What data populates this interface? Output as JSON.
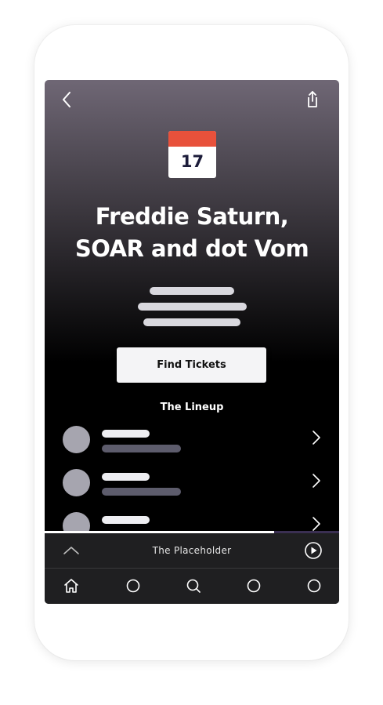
{
  "event": {
    "date_day": "17",
    "title_line1": "Freddie Saturn,",
    "title_line2": "SOAR and dot Vom"
  },
  "actions": {
    "find_tickets_label": "Find Tickets"
  },
  "lineup": {
    "heading": "The Lineup"
  },
  "player": {
    "track_title": "The Placeholder",
    "progress": 0.78
  },
  "nav": {
    "back_icon": "chevron-left-icon",
    "share_icon": "share-icon",
    "tabs": [
      "home-icon",
      "circle-icon",
      "search-icon",
      "circle-icon",
      "circle-icon"
    ]
  },
  "colors": {
    "calendar_header": "#e8513b",
    "progress_track": "#3a2f52",
    "bar_dark": "#1f1f21"
  }
}
